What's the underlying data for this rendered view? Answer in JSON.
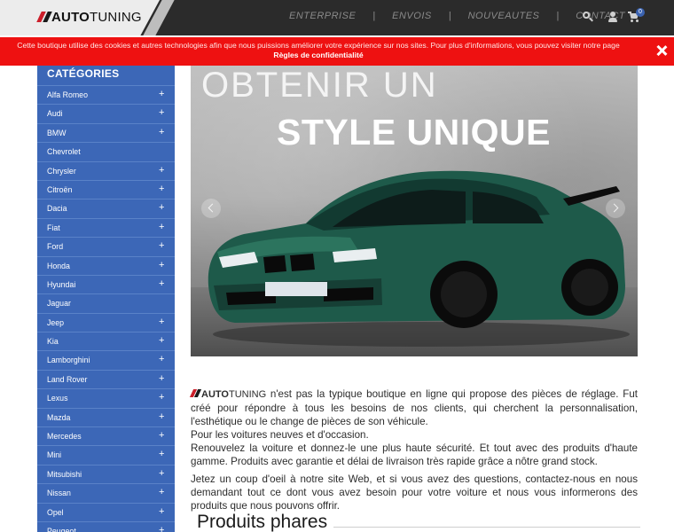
{
  "header": {
    "logo": {
      "bold": "AUTO",
      "light": "TUNING"
    },
    "nav": [
      "ENTERPRISE",
      "ENVOIS",
      "NOUVEAUTES",
      "CONTACT"
    ],
    "nav_separator": "|",
    "icons": [
      "search-icon",
      "user-icon",
      "cart-icon"
    ],
    "cart_count": "0"
  },
  "cookie": {
    "text": "Cette boutique utilise des cookies et autres technologies afin que nous puissions améliorer votre expérience sur nos sites. Pour plus d'informations, vous pouvez visiter notre page ",
    "link": "Règles de confidentialité",
    "close_icon": "close-icon"
  },
  "sidebar": {
    "title": "CATÉGORIES",
    "items": [
      {
        "label": "Alfa Romeo",
        "expand": "+"
      },
      {
        "label": "Audi",
        "expand": "+"
      },
      {
        "label": "BMW",
        "expand": "+"
      },
      {
        "label": "Chevrolet",
        "expand": ""
      },
      {
        "label": "Chrysler",
        "expand": "+"
      },
      {
        "label": "Citroën",
        "expand": "+"
      },
      {
        "label": "Dacia",
        "expand": "+"
      },
      {
        "label": "Fiat",
        "expand": "+"
      },
      {
        "label": "Ford",
        "expand": "+"
      },
      {
        "label": "Honda",
        "expand": "+"
      },
      {
        "label": "Hyundai",
        "expand": "+"
      },
      {
        "label": "Jaguar",
        "expand": ""
      },
      {
        "label": "Jeep",
        "expand": "+"
      },
      {
        "label": "Kia",
        "expand": "+"
      },
      {
        "label": "Lamborghini",
        "expand": "+"
      },
      {
        "label": "Land Rover",
        "expand": "+"
      },
      {
        "label": "Lexus",
        "expand": "+"
      },
      {
        "label": "Mazda",
        "expand": "+"
      },
      {
        "label": "Mercedes",
        "expand": "+"
      },
      {
        "label": "Mini",
        "expand": "+"
      },
      {
        "label": "Mitsubishi",
        "expand": "+"
      },
      {
        "label": "Nissan",
        "expand": "+"
      },
      {
        "label": "Opel",
        "expand": "+"
      },
      {
        "label": "Peugeot",
        "expand": "+"
      }
    ]
  },
  "hero": {
    "line1": "OBTENIR UN",
    "line2": "STYLE UNIQUE",
    "image": "car-photo"
  },
  "intro": {
    "brand_bold": "AUTO",
    "brand_light": "TUNING",
    "p1": " n'est pas la typique boutique en ligne qui propose des pièces de réglage. Fut créé pour répondre à tous les besoins de nos clients, qui cherchent la personnalisation, l'esthétique ou le change de pièces de son véhicule.",
    "p2": "Pour les voitures neuves et d'occasion.",
    "p3": "Renouvelez la voiture et donnez-le une plus haute sécurité. Et tout avec des produits d'haute gamme. Produits avec garantie et délai de livraison très rapide grâce a nôtre grand stock.",
    "p4": "Jetez un coup d'oeil à notre site Web, et si vous avez des questions, contactez-nous en nous demandant tout ce dont vous avez besoin pour votre voiture et nous vous informerons des produits que nous pouvons offrir."
  },
  "section": {
    "title": "Produits phares"
  },
  "colors": {
    "accent": "#3c67b7",
    "cookie": "#ee1111",
    "header": "#2b2b2b",
    "logo_red": "#cc1f2a"
  }
}
